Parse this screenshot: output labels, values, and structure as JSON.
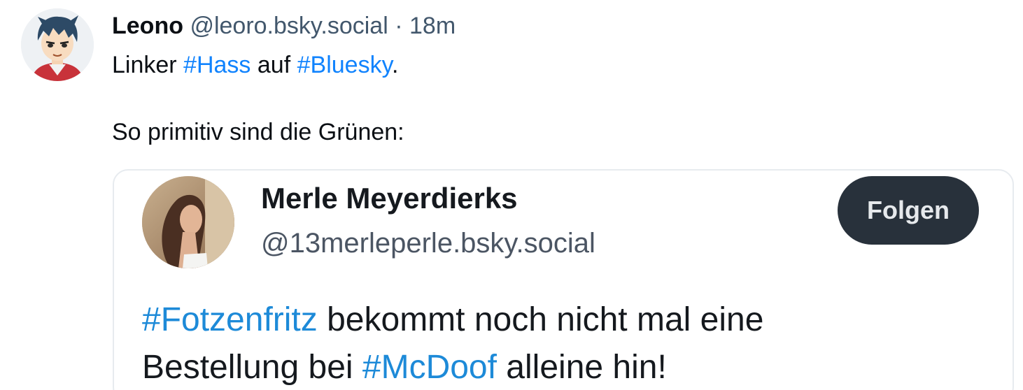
{
  "post": {
    "author_name": "Leono",
    "handle": "@leoro.bsky.social",
    "separator": "·",
    "timestamp": "18m",
    "text_line1": {
      "prefix": "Linker ",
      "hashtag1": "#Hass",
      "middle": " auf ",
      "hashtag2": "#Bluesky",
      "suffix": "."
    },
    "text_line2": "So primitiv sind die Grünen:"
  },
  "embed": {
    "name": "Merle Meyerdierks",
    "handle": "@13merleperle.bsky.social",
    "follow_label": "Folgen",
    "text_line1": {
      "hashtag1": "#Fotzenfritz",
      "rest": " bekommt noch nicht mal eine"
    },
    "text_line2": {
      "prefix": "Bestellung bei ",
      "hashtag2": "#McDoof",
      "suffix": " alleine hin!"
    }
  },
  "colors": {
    "hashtag": "#1083fe",
    "embed_hashtag": "#1d8ad8",
    "follow_button_bg": "#28313b",
    "secondary_text": "#42576c"
  },
  "icons": {
    "post_avatar": "anime-avatar-icon",
    "embed_avatar": "profile-photo"
  }
}
